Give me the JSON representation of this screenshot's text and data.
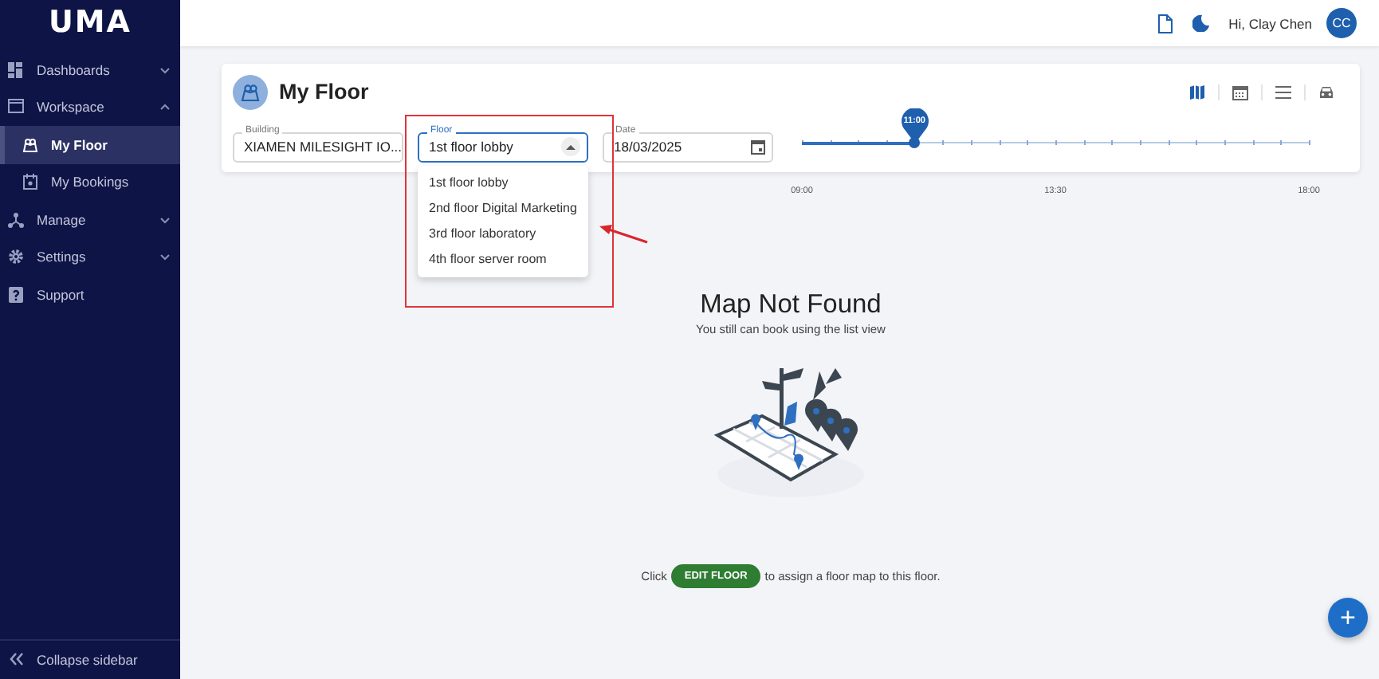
{
  "sidebar": {
    "logo": "UMA",
    "items": [
      {
        "label": "Dashboards",
        "selected": false,
        "expanded": false
      },
      {
        "label": "Workspace",
        "selected": false,
        "expanded": true,
        "children": [
          {
            "label": "My Floor",
            "selected": true
          },
          {
            "label": "My Bookings",
            "selected": false
          }
        ]
      },
      {
        "label": "Manage",
        "selected": false,
        "expanded": false
      },
      {
        "label": "Settings",
        "selected": false,
        "expanded": false
      },
      {
        "label": "Support",
        "selected": false
      }
    ],
    "collapse_label": "Collapse sidebar"
  },
  "top_bar": {
    "greeting": "Hi, Clay Chen",
    "avatar": "CC"
  },
  "page": {
    "title": "My Floor",
    "views": [
      {
        "selected": true
      },
      {
        "selected": false
      },
      {
        "selected": false
      },
      {
        "selected": false
      }
    ],
    "building": {
      "label": "Building",
      "value": "XIAMEN MILESIGHT IO..."
    },
    "floor": {
      "label": "Floor",
      "value": "1st floor lobby",
      "expanded": true,
      "options": [
        "1st floor lobby",
        "2nd floor Digital Marketing",
        "3rd floor laboratory",
        "4th floor server room"
      ]
    },
    "date": {
      "label": "Date",
      "value": "18/03/2025"
    },
    "timeline": {
      "level": 0.222,
      "thumb_label": "11:00",
      "ticks": [
        "09:00",
        "13:30",
        "18:00"
      ]
    }
  },
  "empty_state": {
    "title": "Map Not Found",
    "subtitle": "You still can book using the list view",
    "prefix": "Click",
    "button": "EDIT FLOOR",
    "suffix": "to assign a floor map to this floor."
  },
  "fab": "+",
  "annotations": [
    {
      "kind": "box"
    },
    {
      "kind": "arrow"
    }
  ]
}
